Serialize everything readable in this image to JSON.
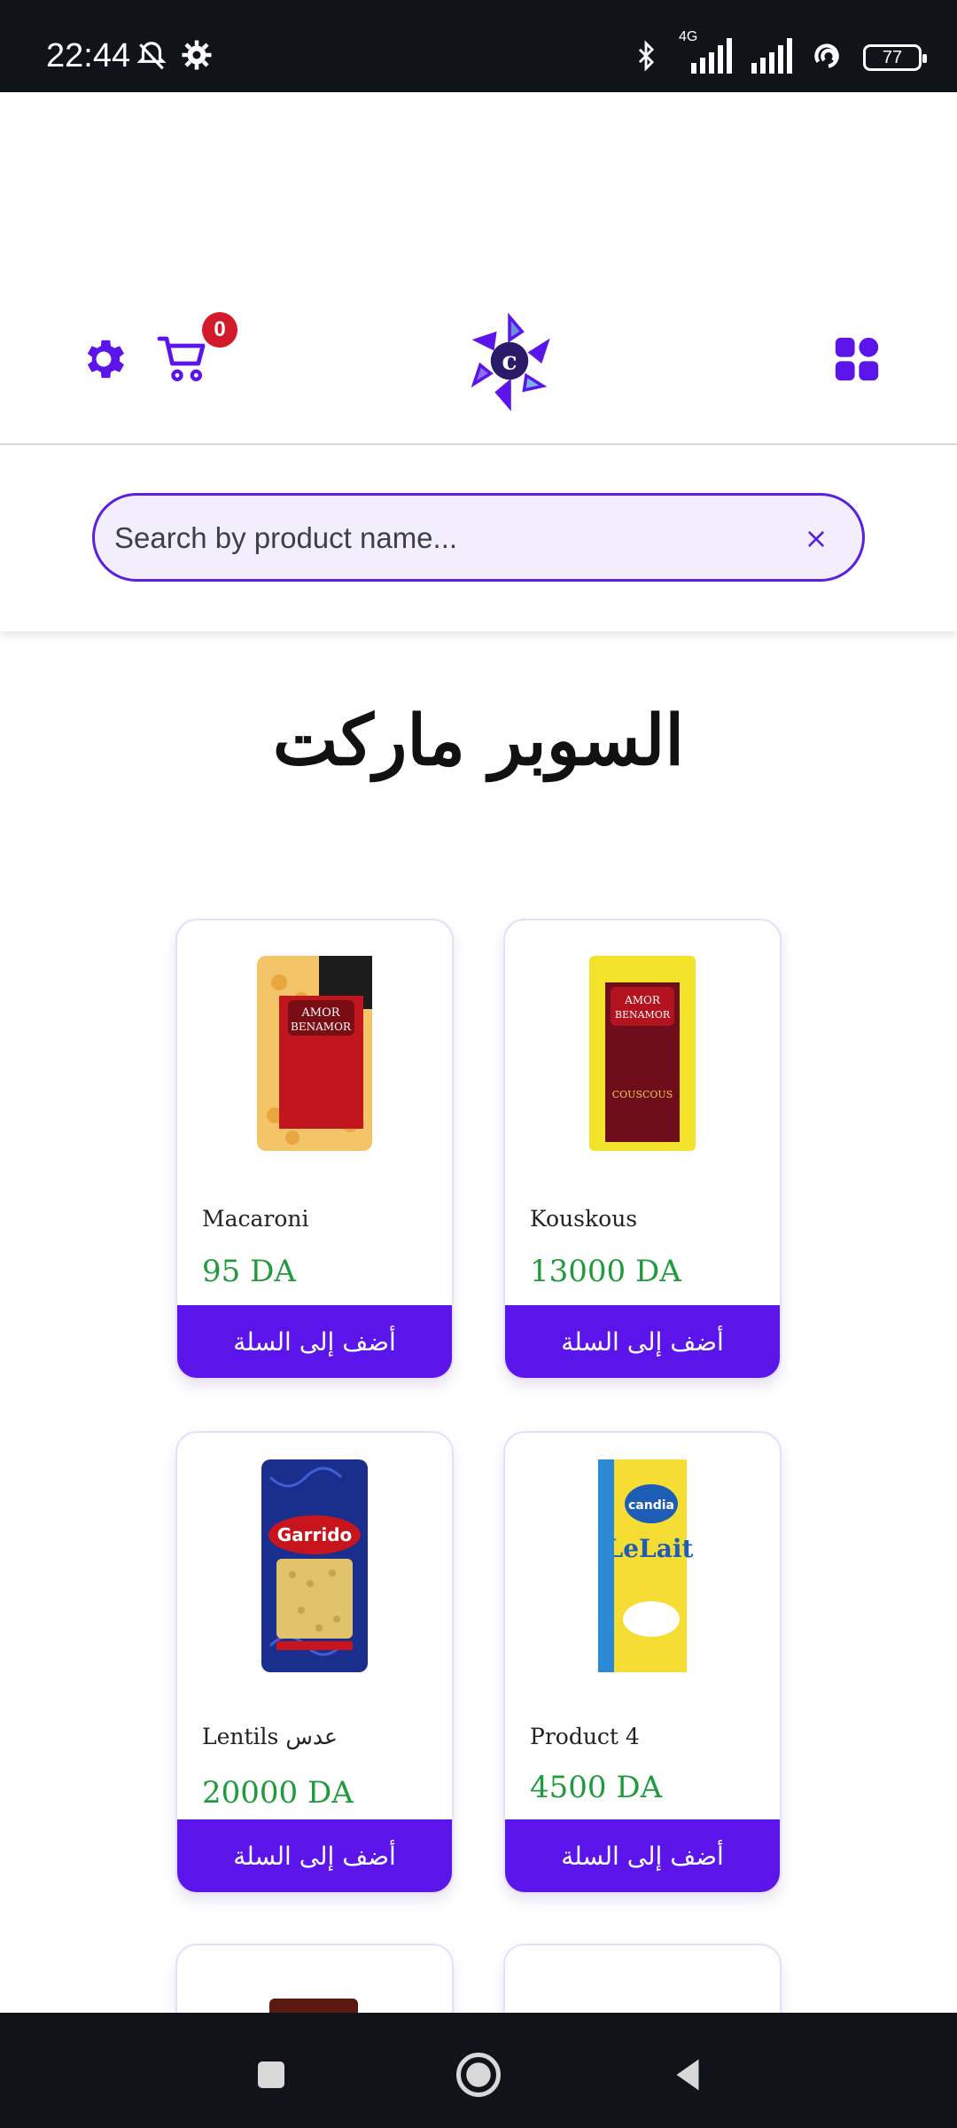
{
  "status_bar": {
    "time": "22:44",
    "network": "4G",
    "battery": "77",
    "icons": [
      "bell-off-icon",
      "gear-icon",
      "bluetooth-icon",
      "signal-icon",
      "signal-icon",
      "hotspot-icon",
      "battery-icon"
    ]
  },
  "header": {
    "cart_count": "0",
    "icons": [
      "settings-icon",
      "cart-icon",
      "logo",
      "grid-icon"
    ]
  },
  "search": {
    "placeholder": "Search by product name...",
    "clear_label": "×"
  },
  "page": {
    "title": "السوبر ماركت"
  },
  "products": [
    {
      "name": "Macaroni",
      "price": "95 DA",
      "button": "أضف إلى السلة"
    },
    {
      "name": "Kouskous",
      "price": "13000 DA",
      "button": "أضف إلى السلة"
    },
    {
      "name": "Lentils عدس",
      "price": "20000 DA",
      "button": "أضف إلى السلة"
    },
    {
      "name": "Product 4",
      "price": "4500 DA",
      "button": "أضف إلى السلة"
    }
  ],
  "colors": {
    "accent": "#5b14ea",
    "price": "#1f9a3c",
    "badge": "#d31a2a",
    "system_bar": "#11131a"
  }
}
